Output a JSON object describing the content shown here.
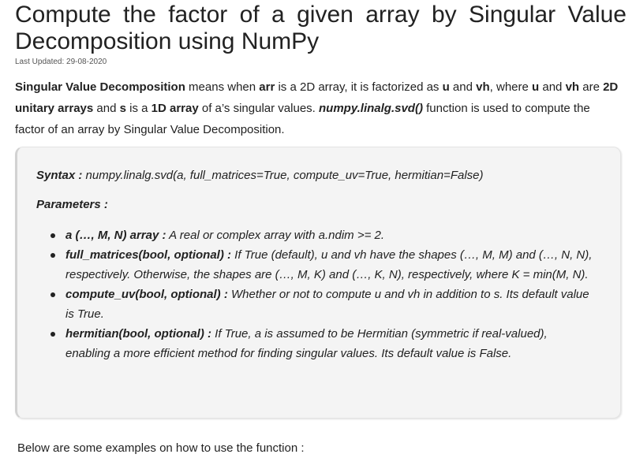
{
  "article": {
    "title": "Compute the factor of a given array by Singular Value Decomposition using NumPy",
    "last_updated": "Last Updated: 29-08-2020",
    "intro": {
      "p1": "Singular Value Decomposition",
      "p2": " means when ",
      "p3": "arr",
      "p4": " is a 2D array, it is factorized as ",
      "p5": "u",
      "p6": " and ",
      "p7": "vh",
      "p8": ", where ",
      "p9": "u",
      "p10": " and ",
      "p11": "vh",
      "p12": " are ",
      "p13": "2D unitary arrays",
      "p14": " and ",
      "p15": "s",
      "p16": " is a ",
      "p17": "1D array",
      "p18": " of a’s singular values. ",
      "p19": "numpy.linalg.svd()",
      "p20": " function is used to compute the factor of an array by Singular Value Decomposition."
    },
    "syntax_label": "Syntax :",
    "syntax_text": " numpy.linalg.svd(a, full_matrices=True, compute_uv=True, hermitian=False)",
    "parameters_heading": "Parameters :",
    "parameters": [
      {
        "name": "a (…, M, N) array :",
        "desc": " A real or complex array with a.ndim >= 2."
      },
      {
        "name": "full_matrices(bool, optional) :",
        "desc": " If True (default), u and vh have the shapes (…, M, M) and (…, N, N), respectively. Otherwise, the shapes are (…, M, K) and (…, K, N), respectively, where K = min(M, N)."
      },
      {
        "name": "compute_uv(bool, optional) :",
        "desc": " Whether or not to compute u and vh in addition to s. Its default value is True."
      },
      {
        "name": "hermitian(bool, optional) :",
        "desc": " If True, a is assumed to be Hermitian (symmetric if real-valued), enabling a more efficient method for finding singular values. Its default value is False."
      }
    ],
    "below_text": "Below are some examples on how to use the function :"
  },
  "colors": {
    "text": "#222222",
    "box_background": "#f4f4f4",
    "box_border": "#d2d2d2"
  }
}
